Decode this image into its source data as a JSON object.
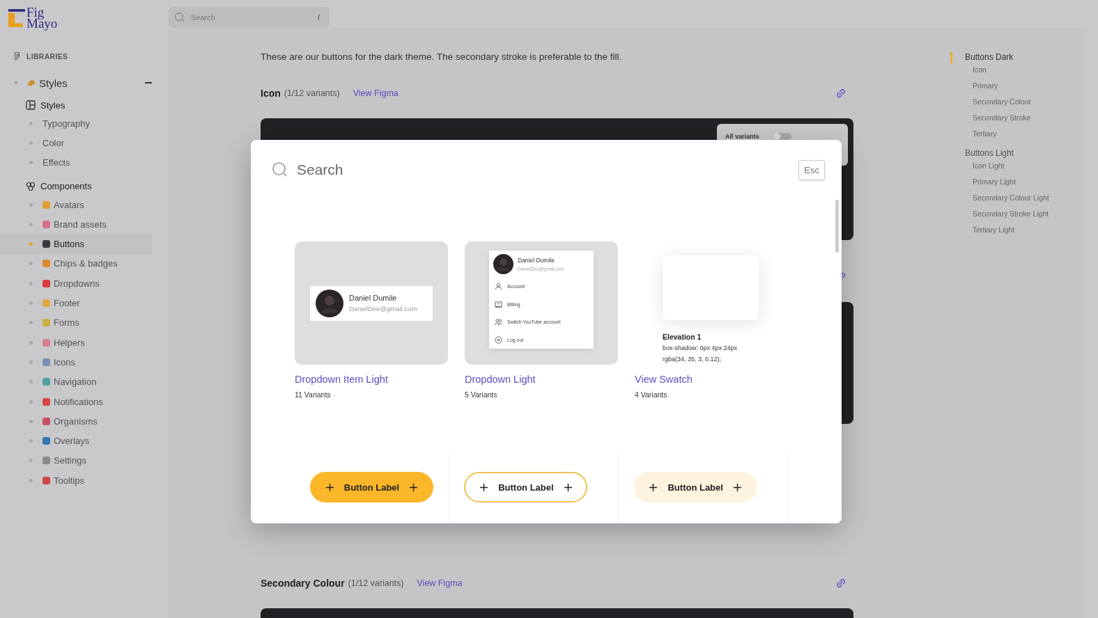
{
  "logo": "Fig Mayo",
  "top_search": {
    "placeholder": "Search",
    "shortcut": "/"
  },
  "sidebar": {
    "section_label": "LIBRARIES",
    "group": {
      "label": "Styles",
      "expanded": true,
      "sections": [
        {
          "label": "Styles",
          "items": [
            {
              "label": "Typography",
              "selected": false
            },
            {
              "label": "Color",
              "selected": false
            },
            {
              "label": "Effects",
              "selected": false
            }
          ]
        },
        {
          "label": "Components",
          "items": [
            {
              "label": "Avatars",
              "selected": false,
              "color": "#e0a030"
            },
            {
              "label": "Brand assets",
              "selected": false,
              "color": "#d8708a"
            },
            {
              "label": "Buttons",
              "selected": true,
              "color": "#3a3a40"
            },
            {
              "label": "Chips & badges",
              "selected": false,
              "color": "#e08a30"
            },
            {
              "label": "Dropdowns",
              "selected": false,
              "color": "#d83a3a"
            },
            {
              "label": "Footer",
              "selected": false,
              "color": "#e0a840"
            },
            {
              "label": "Forms",
              "selected": false,
              "color": "#c8b040"
            },
            {
              "label": "Helpers",
              "selected": false,
              "color": "#d88090"
            },
            {
              "label": "Icons",
              "selected": false,
              "color": "#7890b0"
            },
            {
              "label": "Navigation",
              "selected": false,
              "color": "#50a0a0"
            },
            {
              "label": "Notifications",
              "selected": false,
              "color": "#d84848"
            },
            {
              "label": "Organisms",
              "selected": false,
              "color": "#c85060"
            },
            {
              "label": "Overlays",
              "selected": false,
              "color": "#3878b0"
            },
            {
              "label": "Settings",
              "selected": false,
              "color": "#8a8a8e"
            },
            {
              "label": "Tooltips",
              "selected": false,
              "color": "#d04848"
            }
          ]
        }
      ]
    }
  },
  "intro": "These are our buttons for the dark theme. The secondary stroke is preferable to the fill.",
  "sections": [
    {
      "kind": "titled",
      "title": "Icon",
      "variants": "(1/12 variants)",
      "link": "View Figma",
      "toggle_label": "All variants",
      "toggle_on": false
    },
    {
      "kind": "covered"
    },
    {
      "kind": "titled",
      "title": "Secondary Colour",
      "variants": "(1/12 variants)",
      "link": "View Figma"
    }
  ],
  "toc": [
    {
      "label": "Buttons Dark",
      "selected": true,
      "children": [
        {
          "label": "Icon"
        },
        {
          "label": "Primary"
        },
        {
          "label": "Secondary Colour"
        },
        {
          "label": "Secondary Stroke"
        },
        {
          "label": "Tertiary"
        }
      ]
    },
    {
      "label": "Buttons Light",
      "selected": false,
      "children": [
        {
          "label": "Icon Light"
        },
        {
          "label": "Primary Light"
        },
        {
          "label": "Secondary Colour Light"
        },
        {
          "label": "Secondary Stroke Light"
        },
        {
          "label": "Tertiary Light"
        }
      ]
    }
  ],
  "modal": {
    "placeholder": "Search",
    "esc": "Esc",
    "results": [
      {
        "kind": "item",
        "title": "Dropdown Item Light",
        "count": "11 Variants",
        "name": "Daniel Dumile",
        "email": "DanielDee@gmail.com"
      },
      {
        "kind": "menu",
        "title": "Dropdown Light",
        "count": "5 Variants",
        "name": "Daniel Dumile",
        "email": "DanielDee@gmail.com",
        "menu": [
          "Account",
          "Billing",
          "Switch YouTube account",
          "Log out"
        ]
      },
      {
        "kind": "swatch",
        "title": "View Swatch",
        "count": "4 Variants",
        "swatch_title": "Elevation 1",
        "swatch_text": "box-shadow: 0px 4px 24px rgba(34, 35, 3, 0.12);"
      }
    ],
    "buttons": [
      {
        "kind": "fill",
        "label": "Button Label"
      },
      {
        "kind": "stroke",
        "label": "Button Label"
      },
      {
        "kind": "tint",
        "label": "Button Label"
      }
    ]
  }
}
